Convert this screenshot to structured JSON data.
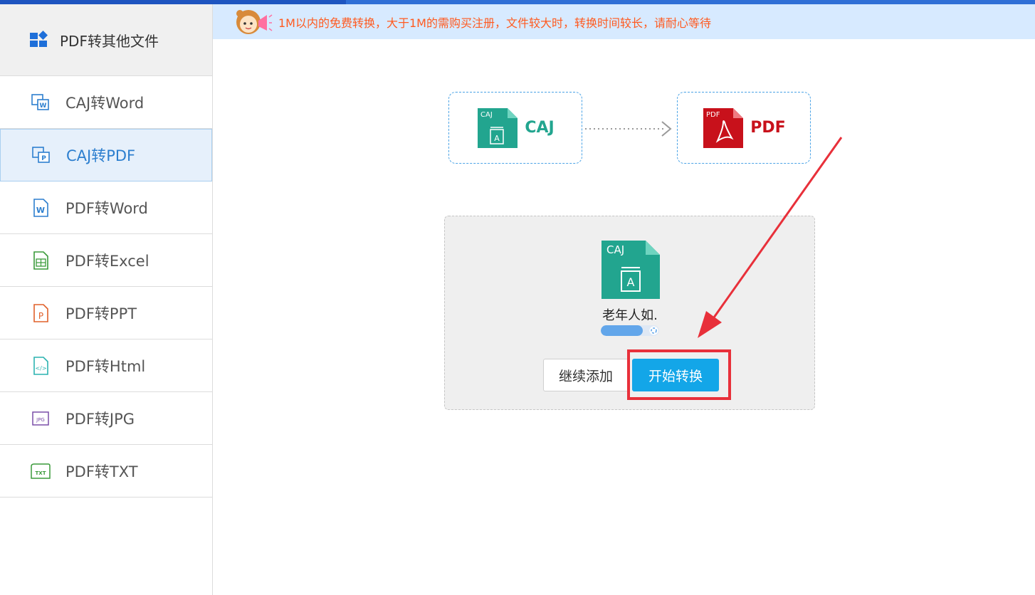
{
  "sidebar": {
    "header_label": "PDF转其他文件",
    "items": [
      {
        "label": "CAJ转Word",
        "icon": "caj-word-icon",
        "color": "#2d7fcf"
      },
      {
        "label": "CAJ转PDF",
        "icon": "caj-pdf-icon",
        "color": "#2d7fcf"
      },
      {
        "label": "PDF转Word",
        "icon": "word-doc-icon",
        "color": "#2d7fcf"
      },
      {
        "label": "PDF转Excel",
        "icon": "excel-doc-icon",
        "color": "#3a9a3a"
      },
      {
        "label": "PDF转PPT",
        "icon": "ppt-doc-icon",
        "color": "#e0602a"
      },
      {
        "label": "PDF转Html",
        "icon": "html-doc-icon",
        "color": "#2bb3b0"
      },
      {
        "label": "PDF转JPG",
        "icon": "jpg-doc-icon",
        "color": "#7a4ea8"
      },
      {
        "label": "PDF转TXT",
        "icon": "txt-doc-icon",
        "color": "#3a9a3a"
      }
    ],
    "active_index": 1
  },
  "notice": {
    "text": "1M以内的免费转换，大于1M的需购买注册，文件较大时，转换时间较长，请耐心等待"
  },
  "flow": {
    "source_label": "CAJ",
    "source_tag": "CAJ",
    "source_color": "#22a58f",
    "target_label": "PDF",
    "target_tag": "PDF",
    "target_color": "#c8111b"
  },
  "upload": {
    "file_tag": "CAJ",
    "file_glyph": "A",
    "file_name": "老年人如.",
    "progress_fraction": 0.72,
    "add_button_label": "继续添加",
    "start_button_label": "开始转换"
  },
  "colors": {
    "accent": "#13a6e8",
    "highlight": "#e8303a",
    "notice_bg": "#d7eaff",
    "notice_text": "#ff5a1f"
  }
}
